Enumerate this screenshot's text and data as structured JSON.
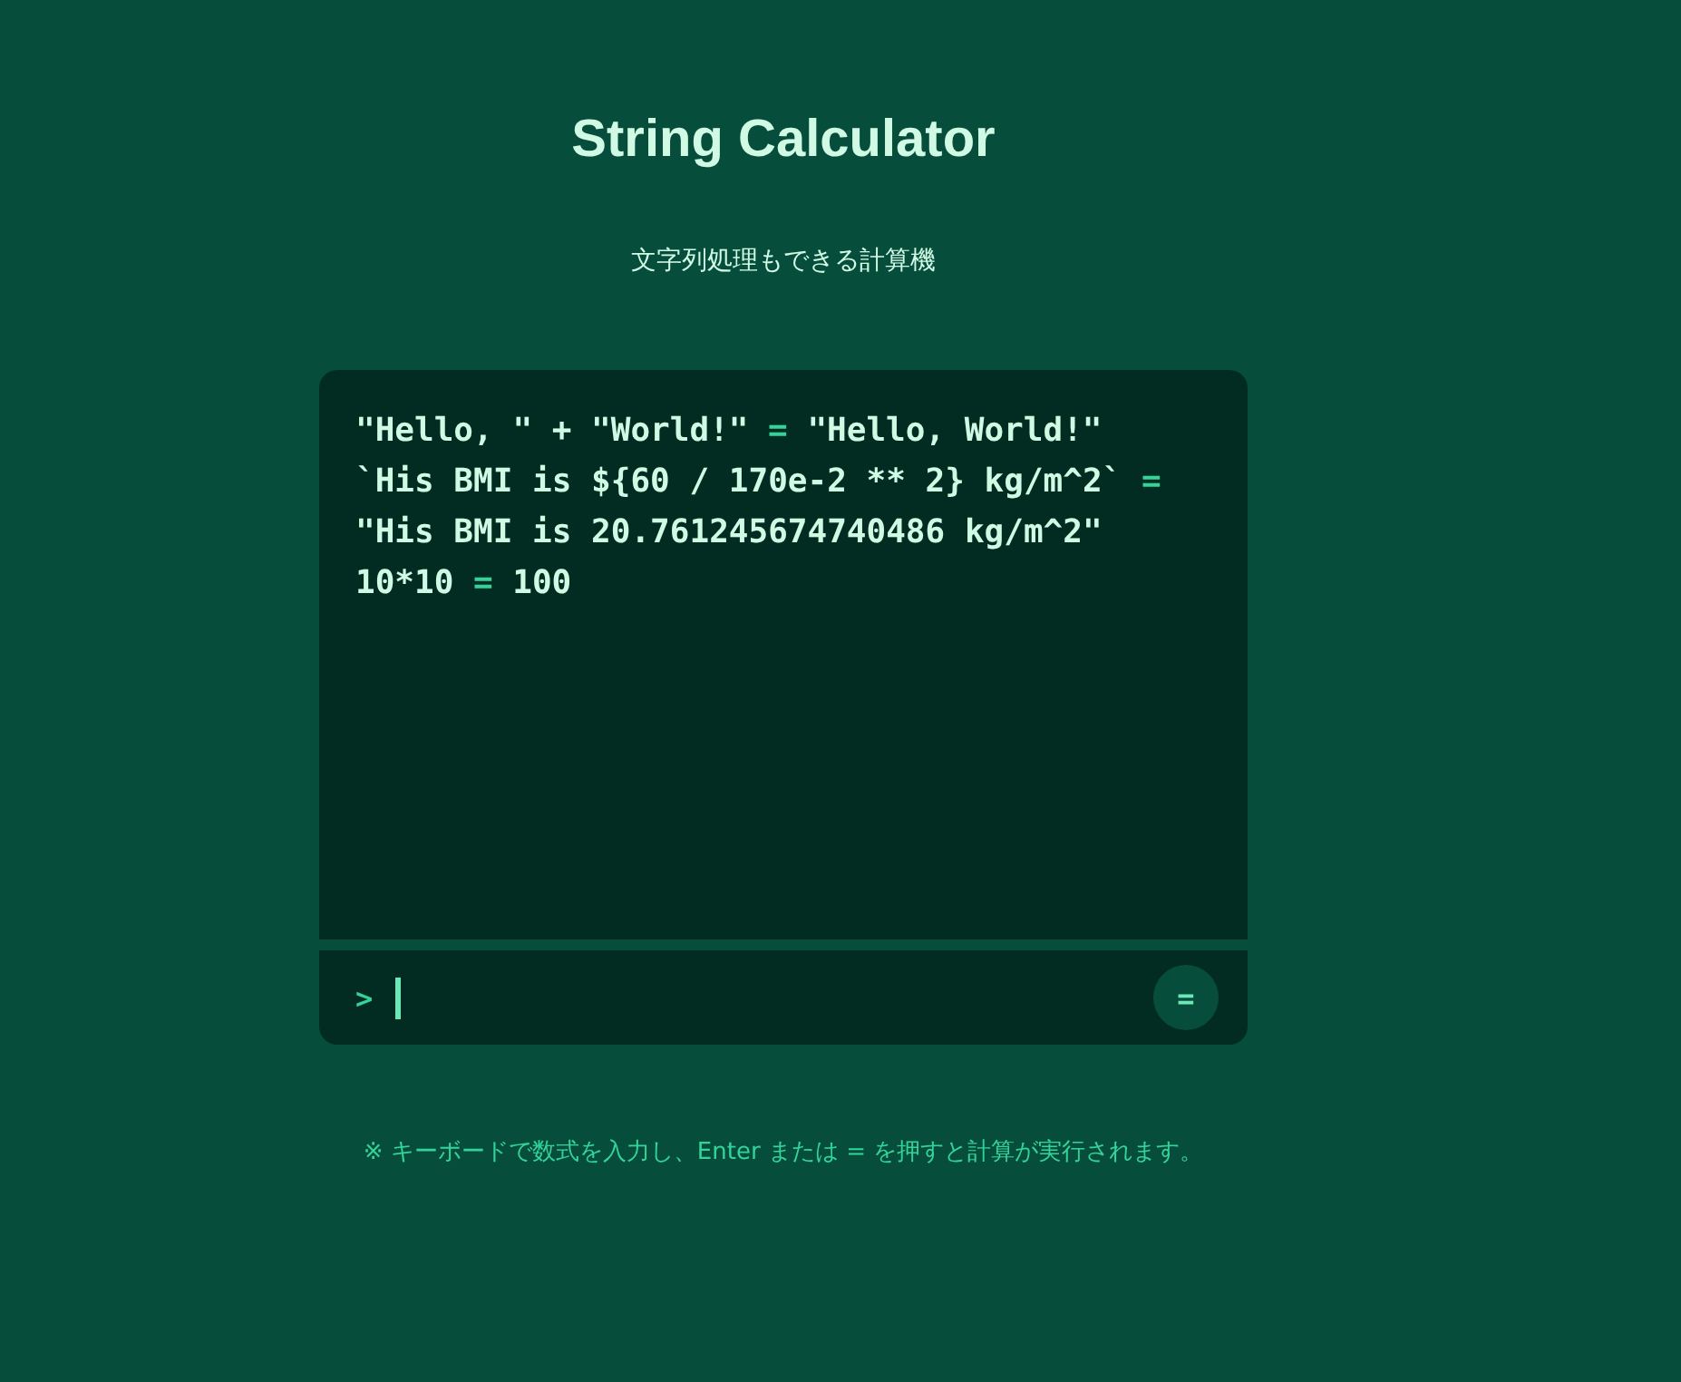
{
  "header": {
    "title": "String Calculator",
    "subtitle": "文字列処理もできる計算機"
  },
  "history": [
    {
      "expression": "\"Hello, \" + \"World!\"",
      "separator": "=",
      "result": "\"Hello, World!\""
    },
    {
      "expression": "`His BMI is ${60 / 170e-2 ** 2} kg/m^2`",
      "separator": "=",
      "result": "\"His BMI is 20.761245674740486 kg/m^2\""
    },
    {
      "expression": "10*10",
      "separator": "=",
      "result": "100"
    }
  ],
  "input": {
    "prompt": ">",
    "focused": true
  },
  "equals_button": {
    "label": "="
  },
  "note": "※ キーボードで数式を入力し、Enter または = を押すと計算が実行されます。"
}
